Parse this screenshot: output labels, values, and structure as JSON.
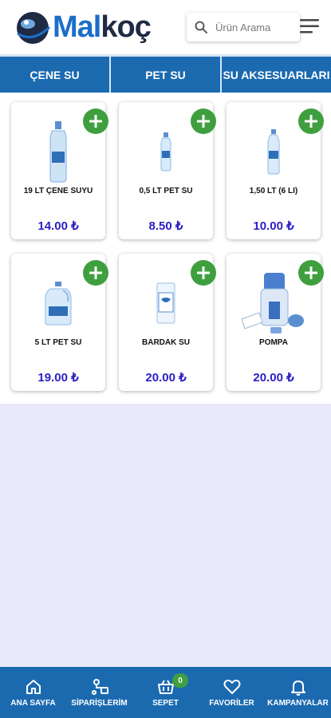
{
  "header": {
    "logo_part1": "Mal",
    "logo_part2": "koç",
    "search_placeholder": "Ürün Arama"
  },
  "categories": [
    {
      "label": "ÇENE SU"
    },
    {
      "label": "PET SU"
    },
    {
      "label": "SU AKSESUARLARI"
    }
  ],
  "products": [
    {
      "name": "19 LT ÇENE SUYU",
      "price": "14.00 ₺",
      "icon": "water-jug-icon"
    },
    {
      "name": "0,5 LT PET SU",
      "price": "8.50 ₺",
      "icon": "small-bottle-icon"
    },
    {
      "name": "1,50 LT (6 LI)",
      "price": "10.00 ₺",
      "icon": "bottle-icon"
    },
    {
      "name": "5 LT PET SU",
      "price": "19.00 ₺",
      "icon": "water-can-icon"
    },
    {
      "name": "BARDAK SU",
      "price": "20.00 ₺",
      "icon": "cup-water-icon"
    },
    {
      "name": "POMPA",
      "price": "20.00 ₺",
      "icon": "pump-icon"
    }
  ],
  "bottom_nav": [
    {
      "label": "ANA SAYFA",
      "icon": "home-icon"
    },
    {
      "label": "SİPARİŞLERİM",
      "icon": "orders-icon"
    },
    {
      "label": "SEPET",
      "icon": "basket-icon",
      "badge": "0"
    },
    {
      "label": "FAVORİLER",
      "icon": "heart-icon"
    },
    {
      "label": "KAMPANYALAR",
      "icon": "bell-icon"
    }
  ],
  "colors": {
    "primary": "#1b6ab0",
    "add_button": "#3f9f3f",
    "price": "#2b1fc4",
    "background": "#e9e9fb"
  }
}
